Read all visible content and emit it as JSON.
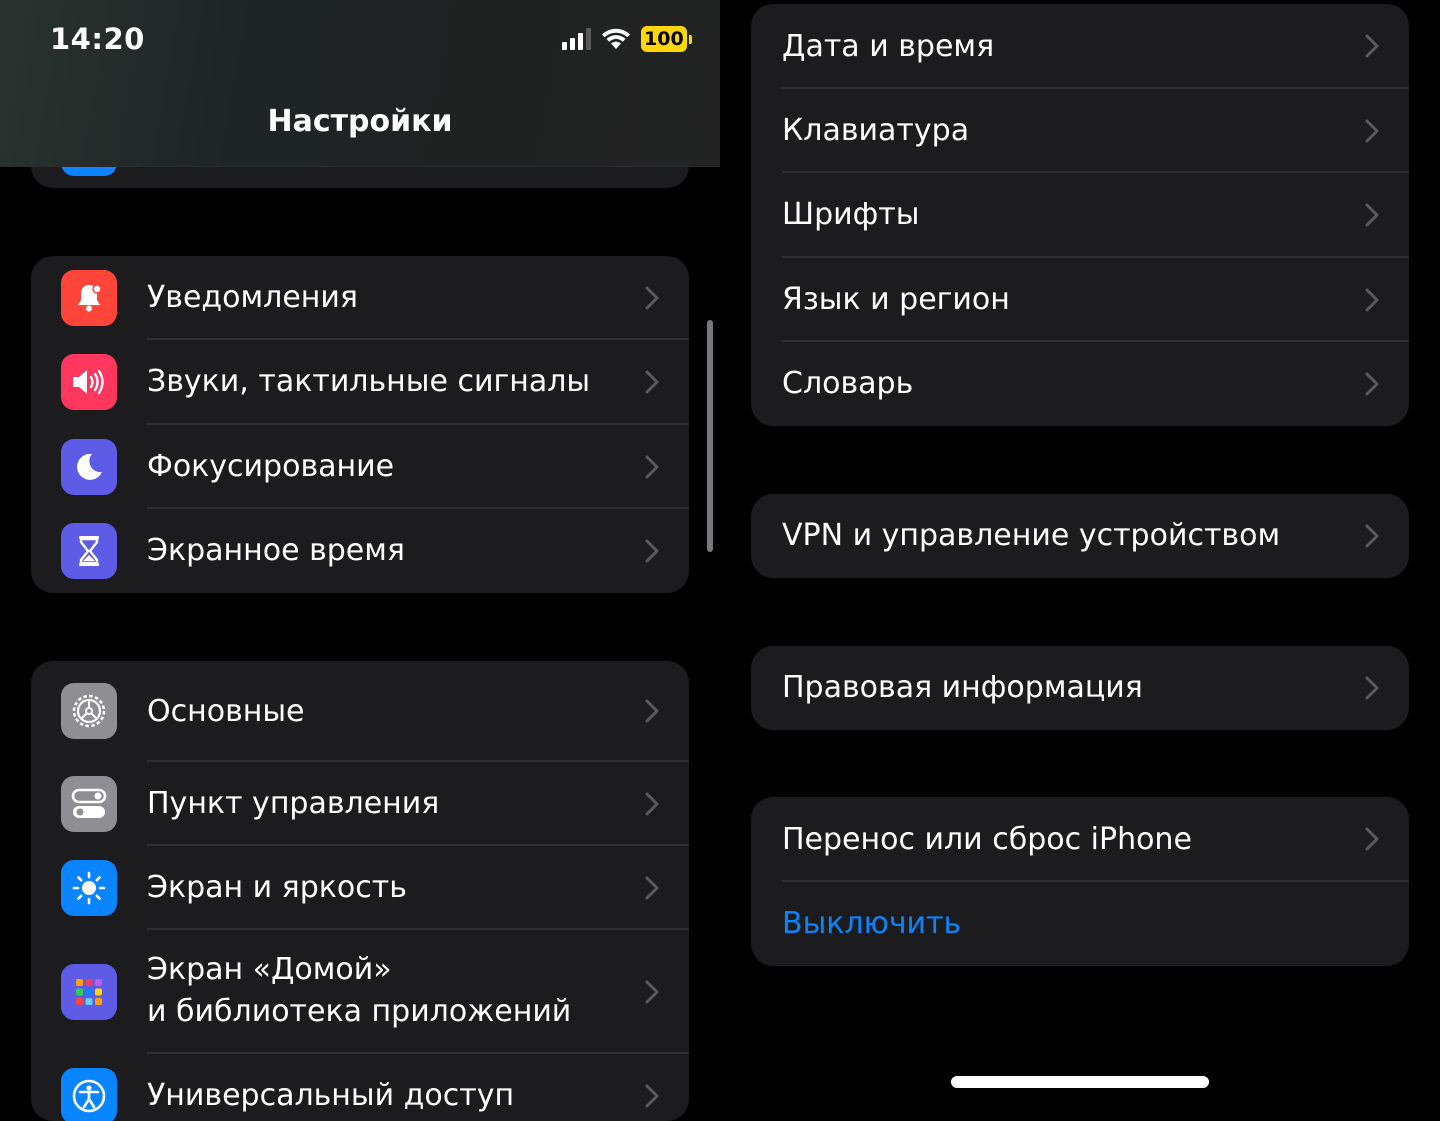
{
  "status_bar": {
    "time": "14:20",
    "battery": "100"
  },
  "nav": {
    "title": "Настройки"
  },
  "left": {
    "group1": [
      {
        "label": "Уведомления",
        "icon": "bell-icon",
        "color": "#ff453a"
      },
      {
        "label": "Звуки, тактильные сигналы",
        "icon": "speaker-icon",
        "color": "#ff375f"
      },
      {
        "label": "Фокусирование",
        "icon": "moon-icon",
        "color": "#5e5ce6"
      },
      {
        "label": "Экранное время",
        "icon": "hourglass-icon",
        "color": "#5e5ce6"
      }
    ],
    "group2": [
      {
        "label": "Основные",
        "icon": "gear-icon",
        "color": "#8e8e93"
      },
      {
        "label": "Пункт управления",
        "icon": "toggles-icon",
        "color": "#8e8e93"
      },
      {
        "label": "Экран и яркость",
        "icon": "sun-icon",
        "color": "#0a84ff"
      },
      {
        "label_line1": "Экран «Домой»",
        "label_line2": "и библиотека приложений",
        "icon": "app-grid-icon",
        "color": "#5e5ce6"
      },
      {
        "label": "Универсальный доступ",
        "icon": "accessibility-icon",
        "color": "#0a84ff"
      }
    ]
  },
  "right": {
    "group1": [
      {
        "label": "Дата и время"
      },
      {
        "label": "Клавиатура"
      },
      {
        "label": "Шрифты"
      },
      {
        "label": "Язык и регион"
      },
      {
        "label": "Словарь"
      }
    ],
    "group2": [
      {
        "label": "VPN и управление устройством"
      }
    ],
    "group3": [
      {
        "label": "Правовая информация"
      }
    ],
    "group4": [
      {
        "label": "Перенос или сброс iPhone"
      },
      {
        "label": "Выключить",
        "color": "#0a84ff"
      }
    ]
  },
  "colors": {
    "background": "#000000",
    "cell": "#1c1c1e",
    "separator": "#2e2e30",
    "link": "#0a84ff",
    "chevron": "#5a5a5e"
  }
}
